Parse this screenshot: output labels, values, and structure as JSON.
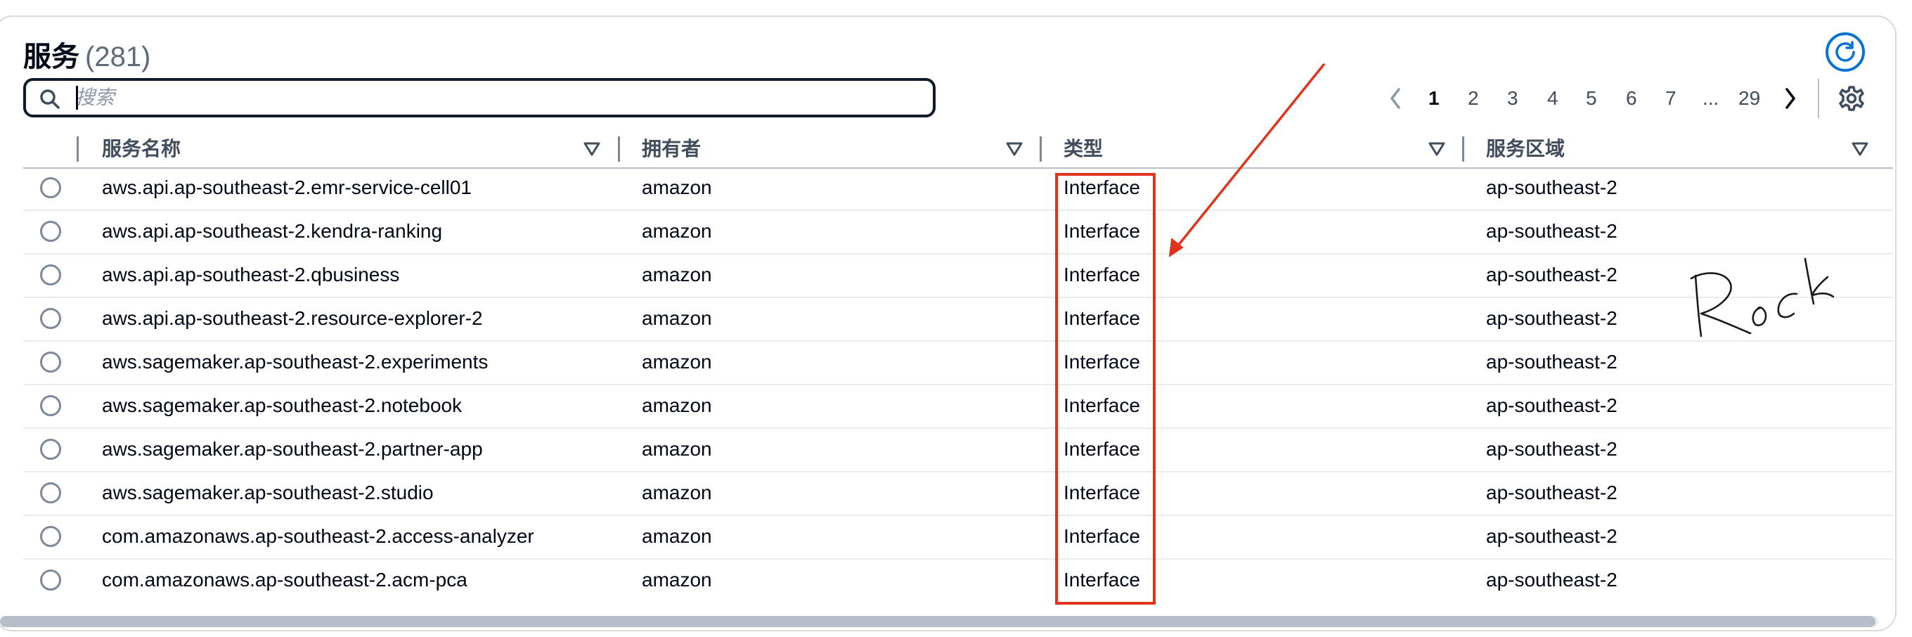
{
  "header": {
    "title": "服务",
    "count": "(281)"
  },
  "search": {
    "placeholder": "搜索",
    "value": ""
  },
  "pagination": {
    "pages": [
      "1",
      "2",
      "3",
      "4",
      "5",
      "6",
      "7",
      "...",
      "29"
    ],
    "current": "1"
  },
  "table": {
    "columns": [
      "服务名称",
      "拥有者",
      "类型",
      "服务区域"
    ],
    "rows": [
      {
        "name": "aws.api.ap-southeast-2.emr-service-cell01",
        "owner": "amazon",
        "type": "Interface",
        "region": "ap-southeast-2"
      },
      {
        "name": "aws.api.ap-southeast-2.kendra-ranking",
        "owner": "amazon",
        "type": "Interface",
        "region": "ap-southeast-2"
      },
      {
        "name": "aws.api.ap-southeast-2.qbusiness",
        "owner": "amazon",
        "type": "Interface",
        "region": "ap-southeast-2"
      },
      {
        "name": "aws.api.ap-southeast-2.resource-explorer-2",
        "owner": "amazon",
        "type": "Interface",
        "region": "ap-southeast-2"
      },
      {
        "name": "aws.sagemaker.ap-southeast-2.experiments",
        "owner": "amazon",
        "type": "Interface",
        "region": "ap-southeast-2"
      },
      {
        "name": "aws.sagemaker.ap-southeast-2.notebook",
        "owner": "amazon",
        "type": "Interface",
        "region": "ap-southeast-2"
      },
      {
        "name": "aws.sagemaker.ap-southeast-2.partner-app",
        "owner": "amazon",
        "type": "Interface",
        "region": "ap-southeast-2"
      },
      {
        "name": "aws.sagemaker.ap-southeast-2.studio",
        "owner": "amazon",
        "type": "Interface",
        "region": "ap-southeast-2"
      },
      {
        "name": "com.amazonaws.ap-southeast-2.access-analyzer",
        "owner": "amazon",
        "type": "Interface",
        "region": "ap-southeast-2"
      },
      {
        "name": "com.amazonaws.ap-southeast-2.acm-pca",
        "owner": "amazon",
        "type": "Interface",
        "region": "ap-southeast-2"
      }
    ]
  },
  "annotations": {
    "signature": "Rock",
    "color": "#e0341f"
  },
  "icons": {
    "refresh": "refresh-icon",
    "search": "search-icon",
    "settings": "gear-icon",
    "prev": "chevron-left-icon",
    "next": "chevron-right-icon",
    "sort": "sort-down-icon"
  },
  "colors": {
    "accent": "#0972d3",
    "text": "#000716",
    "muted": "#5f6b7a"
  }
}
